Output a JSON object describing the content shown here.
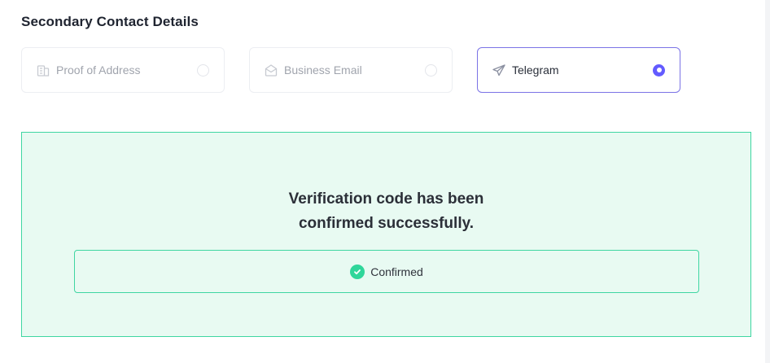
{
  "section": {
    "title": "Secondary Contact Details"
  },
  "options": [
    {
      "label": "Proof of Address",
      "icon": "building-icon",
      "selected": false
    },
    {
      "label": "Business Email",
      "icon": "envelope-open-icon",
      "selected": false
    },
    {
      "label": "Telegram",
      "icon": "telegram-paper-plane-icon",
      "selected": true
    }
  ],
  "verification": {
    "message_line1": "Verification code has been",
    "message_line2": "confirmed successfully.",
    "status_label": "Confirmed",
    "status_icon": "check-circle-icon"
  },
  "colors": {
    "accent": "#635bff",
    "selected_border": "#7b73e6",
    "success_bg": "#e8faf2",
    "success_border": "#3fd6a2",
    "success_check": "#2fd69a"
  }
}
